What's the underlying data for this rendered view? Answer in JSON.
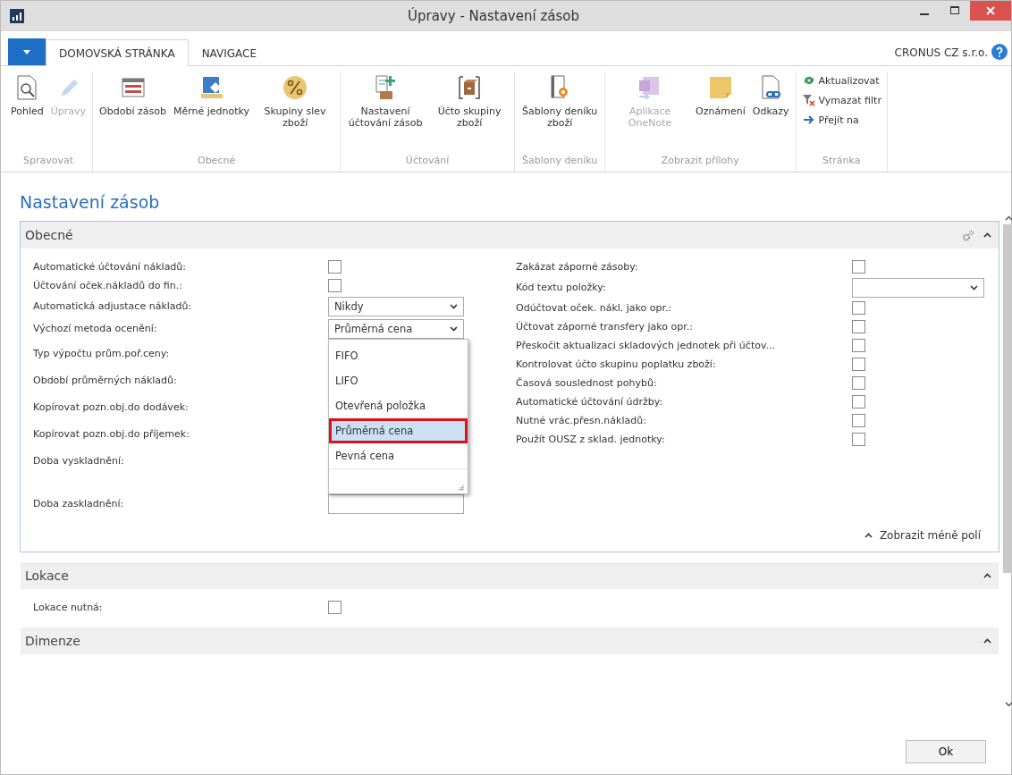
{
  "window": {
    "title": "Úpravy - Nastavení zásob"
  },
  "ribbon": {
    "tabs": [
      {
        "label": "DOMOVSKÁ STRÁNKA",
        "selected": true
      },
      {
        "label": "NAVIGACE",
        "selected": false
      }
    ],
    "company": "CRONUS CZ s.r.o.",
    "groups": [
      {
        "label": "Spravovat",
        "kind": "large",
        "items": [
          {
            "label": "Pohled",
            "disabled": false
          },
          {
            "label": "Úpravy",
            "disabled": true
          }
        ]
      },
      {
        "label": "Obecné",
        "kind": "large",
        "items": [
          {
            "label": "Období zásob",
            "disabled": false
          },
          {
            "label": "Měrné jednotky",
            "disabled": false
          },
          {
            "label": "Skupiny slev zboží",
            "disabled": false
          }
        ]
      },
      {
        "label": "Účtování",
        "kind": "large",
        "items": [
          {
            "label": "Nastavení účtování zásob",
            "disabled": false
          },
          {
            "label": "Účto skupiny zboží",
            "disabled": false
          }
        ]
      },
      {
        "label": "Šablony deníku",
        "kind": "large",
        "items": [
          {
            "label": "Šablony deníku zboží",
            "disabled": false
          }
        ]
      },
      {
        "label": "Zobrazit přílohy",
        "kind": "large",
        "items": [
          {
            "label": "Aplikace OneNote",
            "disabled": true
          },
          {
            "label": "Oznámení",
            "disabled": false
          },
          {
            "label": "Odkazy",
            "disabled": false
          }
        ]
      },
      {
        "label": "Stránka",
        "kind": "small",
        "items": [
          {
            "label": "Aktualizovat",
            "disabled": false
          },
          {
            "label": "Vymazat filtr",
            "disabled": false
          },
          {
            "label": "Přejít na",
            "disabled": false
          }
        ]
      }
    ]
  },
  "page_title": "Nastavení zásob",
  "sections": [
    {
      "title": "Obecné",
      "expanded": true,
      "focused": true,
      "left": [
        {
          "label": "Automatické účtování nákladů:",
          "kind": "checkbox",
          "checked": false
        },
        {
          "label": "Účtování oček.nákladů do fin.:",
          "kind": "checkbox",
          "checked": false
        },
        {
          "label": "Automatická adjustace nákladů:",
          "kind": "select",
          "value": "Nikdy"
        },
        {
          "label": "Výchozí metoda ocenění:",
          "kind": "select",
          "value": "Průměrná cena",
          "options": [
            {
              "label": "FIFO",
              "selected": false
            },
            {
              "label": "LIFO",
              "selected": false
            },
            {
              "label": "Otevřená položka",
              "selected": false
            },
            {
              "label": "Průměrná cena",
              "selected": true
            },
            {
              "label": "Pevná cena",
              "selected": false
            }
          ]
        },
        {
          "label": "Typ výpočtu prům.poř.ceny:",
          "kind": "hidden"
        },
        {
          "label": "Období průměrných nákladů:",
          "kind": "hidden"
        },
        {
          "label": "Kopírovat pozn.obj.do dodávek:",
          "kind": "hidden"
        },
        {
          "label": "Kopírovat pozn.obj.do příjemek:",
          "kind": "hidden"
        },
        {
          "label": "Doba vyskladnění:",
          "kind": "hidden"
        },
        {
          "label": "Doba zaskladnění:",
          "kind": "text"
        }
      ],
      "right": [
        {
          "label": "Zakázat záporné zásoby:",
          "kind": "checkbox",
          "checked": false
        },
        {
          "label": "Kód textu položky:",
          "kind": "select"
        },
        {
          "label": "Odúčtovat oček. nákl. jako opr.:",
          "kind": "checkbox",
          "checked": false
        },
        {
          "label": "Účtovat záporné transfery jako opr.:",
          "kind": "checkbox",
          "checked": false
        },
        {
          "label": "Přeskočit aktualizaci skladových jednotek při účtov...",
          "kind": "checkbox",
          "checked": false
        },
        {
          "label": "Kontrolovat účto skupinu poplatku zboží:",
          "kind": "checkbox",
          "checked": false
        },
        {
          "label": "Časová souslednost pohybů:",
          "kind": "checkbox",
          "checked": false
        },
        {
          "label": "Automatické účtování údržby:",
          "kind": "checkbox",
          "checked": false
        },
        {
          "label": "Nutné vrác.přesn.nákladů:",
          "kind": "checkbox",
          "checked": false
        },
        {
          "label": "Použít OUSZ z sklad. jednotky:",
          "kind": "checkbox",
          "checked": false
        }
      ],
      "footer_link": "Zobrazit méně polí"
    },
    {
      "title": "Lokace",
      "expanded": true,
      "focused": false,
      "left": [
        {
          "label": "Lokace nutná:",
          "kind": "checkbox",
          "checked": false
        }
      ]
    },
    {
      "title": "Dimenze",
      "expanded": true,
      "focused": false
    }
  ],
  "ok_button": "Ok"
}
